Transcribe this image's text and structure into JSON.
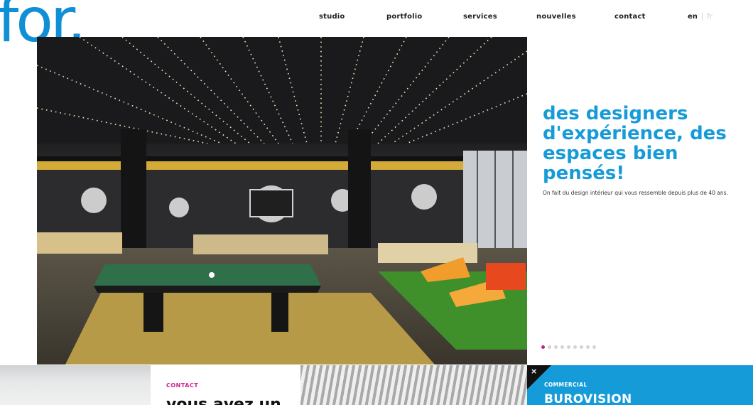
{
  "logo": {
    "text": "for",
    "dot": "."
  },
  "nav": {
    "items": [
      {
        "label": "studio"
      },
      {
        "label": "portfolio"
      },
      {
        "label": "services"
      },
      {
        "label": "nouvelles"
      },
      {
        "label": "contact"
      }
    ]
  },
  "lang": {
    "active": "en",
    "separator": "|",
    "other": "fr"
  },
  "hero": {
    "tagline": "des designers d'expérience, des espaces bien pensés!",
    "subline": "On fait du design intérieur qui vous ressemble depuis plus de 40 ans.",
    "slides_total": 9,
    "active_slide": 1
  },
  "strip": {
    "contact": {
      "label": "CONTACT",
      "heading": "vous avez un"
    },
    "close": {
      "glyph": "×"
    },
    "commercial": {
      "label": "COMMERCIAL",
      "heading": "BUROVISION"
    }
  },
  "colors": {
    "brand_blue": "#169bd9",
    "accent_pink": "#c0209a"
  }
}
